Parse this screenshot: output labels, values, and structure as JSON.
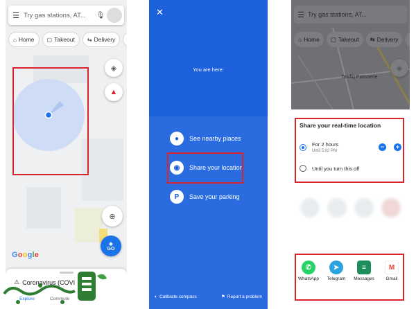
{
  "panel1": {
    "search_placeholder": "Try gas stations, AT...",
    "chips": [
      {
        "icon": "home-icon",
        "label": "Home"
      },
      {
        "icon": "takeout-icon",
        "label": "Takeout"
      },
      {
        "icon": "delivery-icon",
        "label": "Delivery"
      },
      {
        "icon": "gas-icon",
        "label": "Ga"
      }
    ],
    "go_label": "GO",
    "google_logo": "Google",
    "covid_text": "Coronavirus (COVI",
    "bottom_tabs": [
      "Explore",
      "Commute"
    ]
  },
  "panel2": {
    "you_are_here": "You are here:",
    "options": [
      "See nearby places",
      "Share your location",
      "Save your parking"
    ],
    "footer_left": "Calibrate compass",
    "footer_right": "Report a problem"
  },
  "panel3": {
    "search_placeholder": "Try gas stations, AT...",
    "chips": [
      {
        "icon": "home-icon",
        "label": "Home"
      },
      {
        "icon": "takeout-icon",
        "label": "Takeout"
      },
      {
        "icon": "delivery-icon",
        "label": "Delivery"
      },
      {
        "icon": "gas-icon",
        "label": "Ga"
      }
    ],
    "place_label": "Tawfiq Patisserie",
    "sheet_title": "Share your real-time location",
    "option1_title": "For 2 hours",
    "option1_sub": "Until 5:02 PM",
    "option2_title": "Until you turn this off",
    "apps": [
      {
        "name": "WhatsApp",
        "icon": "whatsapp-icon",
        "color": "#25d366"
      },
      {
        "name": "Telegram",
        "icon": "telegram-icon",
        "color": "#2aa3df"
      },
      {
        "name": "Messages",
        "icon": "messages-icon",
        "color": "#1e8e5a"
      },
      {
        "name": "Gmail",
        "icon": "gmail-icon",
        "color": "#ea4335"
      }
    ]
  },
  "colors": {
    "highlight_red": "#d9232d",
    "google_blue": "#1a73e8",
    "share_blue": "#1a5cd8"
  }
}
